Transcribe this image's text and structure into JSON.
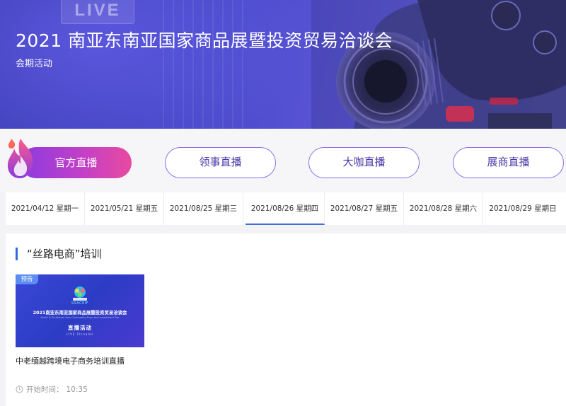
{
  "banner": {
    "title": "2021 南亚东南亚国家商品展暨投资贸易洽谈会",
    "subtitle": "会期活动",
    "board_text": "LIVE"
  },
  "categories": [
    {
      "label": "官方直播",
      "active": true
    },
    {
      "label": "领事直播",
      "active": false
    },
    {
      "label": "大咖直播",
      "active": false
    },
    {
      "label": "展商直播",
      "active": false
    }
  ],
  "dates": [
    {
      "label": "2021/04/12 星期一",
      "active": false
    },
    {
      "label": "2021/05/21 星期五",
      "active": false
    },
    {
      "label": "2021/08/25 星期三",
      "active": false
    },
    {
      "label": "2021/08/26 星期四",
      "active": true
    },
    {
      "label": "2021/08/27 星期五",
      "active": false
    },
    {
      "label": "2021/08/28 星期六",
      "active": false
    },
    {
      "label": "2021/08/29 星期日",
      "active": false
    }
  ],
  "section": {
    "title": "“丝路电商”培训"
  },
  "item": {
    "badge": "预告",
    "thumb_brand": "SSACEIF",
    "thumb_title": "2021南亚东南亚国家商品展暨投资贸易洽谈会",
    "thumb_title_en": "South & Southeast Asia Commodity Expo and Investment Fair",
    "thumb_live": "直播活动",
    "thumb_live_en": "LIVE Streams",
    "title": "中老缅越跨境电子商务培训直播",
    "start_label": "开始时间：",
    "start_time": "10:35"
  },
  "colors": {
    "accent_blue": "#2f6ae0",
    "active_tab_gradient_start": "#8c3be0",
    "active_tab_gradient_end": "#e84aa0",
    "outline_purple": "#8a6ce8"
  }
}
